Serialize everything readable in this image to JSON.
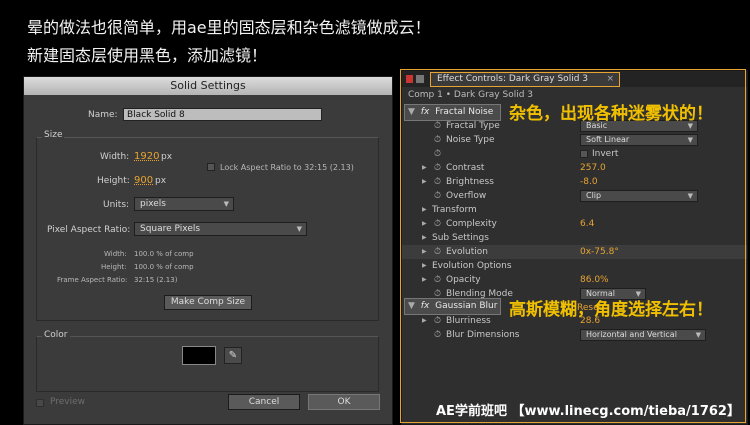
{
  "captions": {
    "line1": "晕的做法也很简单，用ae里的固态层和杂色滤镜做成云！",
    "line2": "新建固态层使用黑色，添加滤镜！"
  },
  "solid_settings": {
    "title": "Solid Settings",
    "name_label": "Name:",
    "name_value": "Black Solid 8",
    "size_group": "Size",
    "width_label": "Width:",
    "width_value": "1920",
    "width_unit": "px",
    "height_label": "Height:",
    "height_value": "900",
    "height_unit": "px",
    "lock_aspect": "Lock Aspect Ratio to 32:15 (2.13)",
    "units_label": "Units:",
    "units_value": "pixels",
    "par_label": "Pixel Aspect Ratio:",
    "par_value": "Square Pixels",
    "info_width_label": "Width:",
    "info_width_value": "100.0 % of comp",
    "info_height_label": "Height:",
    "info_height_value": "100.0 % of comp",
    "info_far_label": "Frame Aspect Ratio:",
    "info_far_value": "32:15 (2.13)",
    "make_comp_size": "Make Comp Size",
    "color_group": "Color",
    "swatch_color": "#000000",
    "preview": "Preview",
    "cancel": "Cancel",
    "ok": "OK"
  },
  "effect_controls": {
    "tab_title": "Effect Controls: Dark Gray Solid 3",
    "breadcrumb": "Comp 1 • Dark Gray Solid 3",
    "fractal_noise": "Fractal Noise",
    "rows": {
      "fractal_type": {
        "label": "Fractal Type",
        "value": "Basic"
      },
      "noise_type": {
        "label": "Noise Type",
        "value": "Soft Linear"
      },
      "invert": {
        "label": "Invert"
      },
      "contrast": {
        "label": "Contrast",
        "value": "257.0"
      },
      "brightness": {
        "label": "Brightness",
        "value": "-8.0"
      },
      "overflow": {
        "label": "Overflow",
        "value": "Clip"
      },
      "transform": {
        "label": "Transform"
      },
      "complexity": {
        "label": "Complexity",
        "value": "6.4"
      },
      "sub_settings": {
        "label": "Sub Settings"
      },
      "evolution": {
        "label": "Evolution",
        "value": "0x-75.8°"
      },
      "evolution_options": {
        "label": "Evolution Options"
      },
      "opacity": {
        "label": "Opacity",
        "value": "86.0%"
      },
      "blending_mode": {
        "label": "Blending Mode",
        "value": "Normal"
      },
      "reset": {
        "label": "Reset"
      },
      "blurriness": {
        "label": "Blurriness",
        "value": "28.6"
      },
      "blur_dimensions": {
        "label": "Blur Dimensions",
        "value": "Horizontal and Vertical"
      }
    },
    "gaussian_blur": "Gaussian Blur"
  },
  "annotations": {
    "noise_note": "杂色，出现各种迷雾状的！",
    "blur_note": "高斯模糊，角度选择左右！"
  },
  "watermark": "AE学前班吧 【www.linecg.com/tieba/1762】",
  "colors": {
    "accent": "#e8a431",
    "annotation": "#f0c000"
  }
}
